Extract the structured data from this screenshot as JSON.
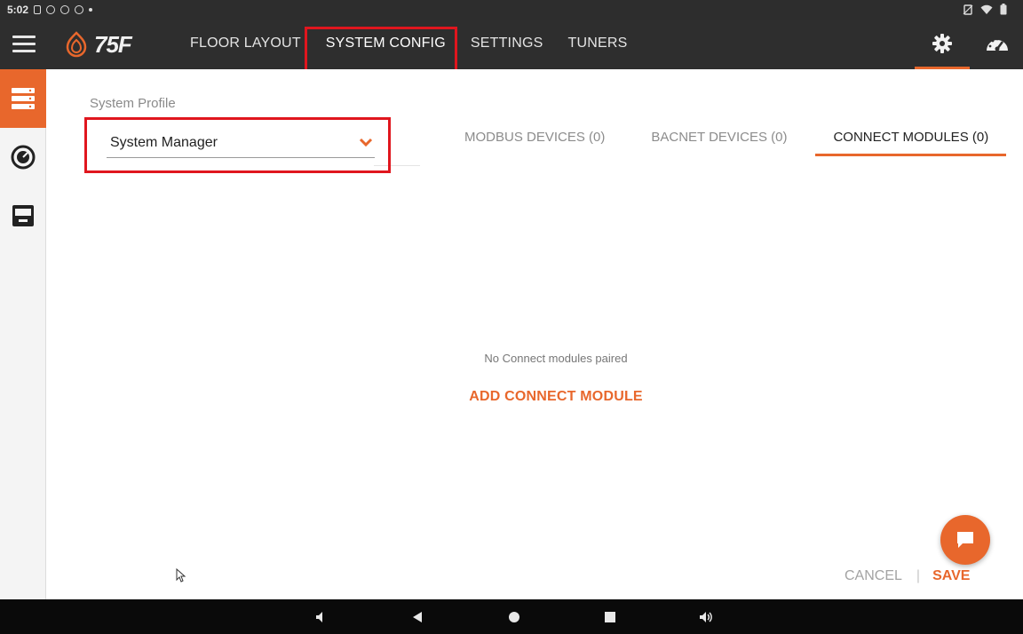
{
  "status_bar": {
    "time": "5:02"
  },
  "app_bar": {
    "logo_text": "75F",
    "tabs": [
      {
        "label": "FLOOR LAYOUT"
      },
      {
        "label": "SYSTEM CONFIG"
      },
      {
        "label": "SETTINGS"
      },
      {
        "label": "TUNERS"
      }
    ],
    "selected_tab": "SYSTEM CONFIG",
    "right_icons": [
      "gear-icon",
      "speedometer-icon"
    ]
  },
  "sidebar": {
    "items": [
      {
        "icon": "server-list-icon",
        "active": true
      },
      {
        "icon": "dial-meter-icon",
        "active": false
      },
      {
        "icon": "thermostat-device-icon",
        "active": false
      }
    ]
  },
  "main": {
    "profile_label": "System Profile",
    "profile_value": "System Manager",
    "sub_tabs": [
      {
        "label": "MODBUS DEVICES (0)",
        "active": false
      },
      {
        "label": "BACNET DEVICES (0)",
        "active": false
      },
      {
        "label": "CONNECT MODULES (0)",
        "active": true
      }
    ],
    "empty_message": "No Connect modules paired",
    "add_button": "ADD CONNECT MODULE",
    "cancel_label": "CANCEL",
    "separator": "|",
    "save_label": "SAVE"
  },
  "colors": {
    "accent": "#e8672c",
    "app_bar_bg": "#2e2e2e",
    "highlight_red": "#e0161e"
  },
  "android_nav": [
    "volume-down-icon",
    "back-icon",
    "home-icon",
    "recents-icon",
    "volume-up-icon"
  ]
}
